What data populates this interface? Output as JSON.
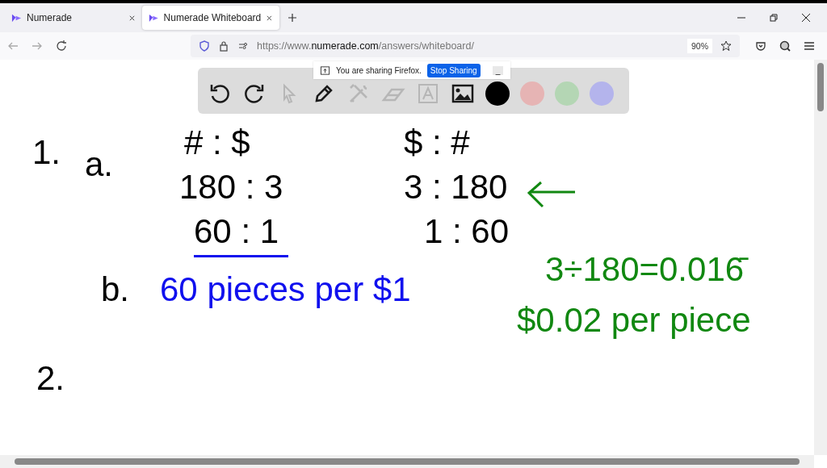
{
  "tabs": [
    {
      "label": "Numerade",
      "selected": false
    },
    {
      "label": "Numerade Whiteboard",
      "selected": true
    }
  ],
  "address_bar": {
    "scheme": "https://www.",
    "host": "numerade.com",
    "path": "/answers/whiteboard/",
    "zoom": "90%"
  },
  "sharing_bar": {
    "message": "You are sharing Firefox.",
    "button": "Stop Sharing",
    "minimize": "_"
  },
  "toolbar": {
    "tools": [
      {
        "kind": "undo",
        "disabled": false
      },
      {
        "kind": "redo",
        "disabled": false
      },
      {
        "kind": "select",
        "disabled": true
      },
      {
        "kind": "pen",
        "disabled": false
      },
      {
        "kind": "tools",
        "disabled": true
      },
      {
        "kind": "eraser",
        "disabled": true
      },
      {
        "kind": "text",
        "disabled": true
      },
      {
        "kind": "image",
        "disabled": false
      }
    ],
    "colors": [
      {
        "color": "#000000"
      },
      {
        "color": "#e6b4b4"
      },
      {
        "color": "#b4d6b4"
      },
      {
        "color": "#b4b4ec"
      }
    ]
  },
  "whiteboard": {
    "notes": [
      {
        "text": "1.",
        "color": "#000000",
        "underlined": false
      },
      {
        "text": "a.",
        "color": "#000000",
        "underlined": false
      },
      {
        "text": "# : $",
        "color": "#000000",
        "underlined": false
      },
      {
        "text": "180 : 3",
        "color": "#000000",
        "underlined": false
      },
      {
        "text": "60 : 1",
        "color": "#000000",
        "underlined": true
      },
      {
        "text": "$ : #",
        "color": "#000000",
        "underlined": false
      },
      {
        "text": "3 : 180",
        "color": "#000000",
        "underlined": false
      },
      {
        "text": "1 : 60",
        "color": "#000000",
        "underlined": false
      },
      {
        "text": "b.",
        "color": "#000000",
        "underlined": false
      },
      {
        "text": "60 pieces per $1",
        "color": "#1010ee",
        "underlined": false
      },
      {
        "text": "3÷180=0.016̄",
        "color": "#118811",
        "underlined": false
      },
      {
        "text": "$0.02 per piece",
        "color": "#118811",
        "underlined": false
      },
      {
        "text": "2.",
        "color": "#000000",
        "underlined": false
      }
    ]
  }
}
